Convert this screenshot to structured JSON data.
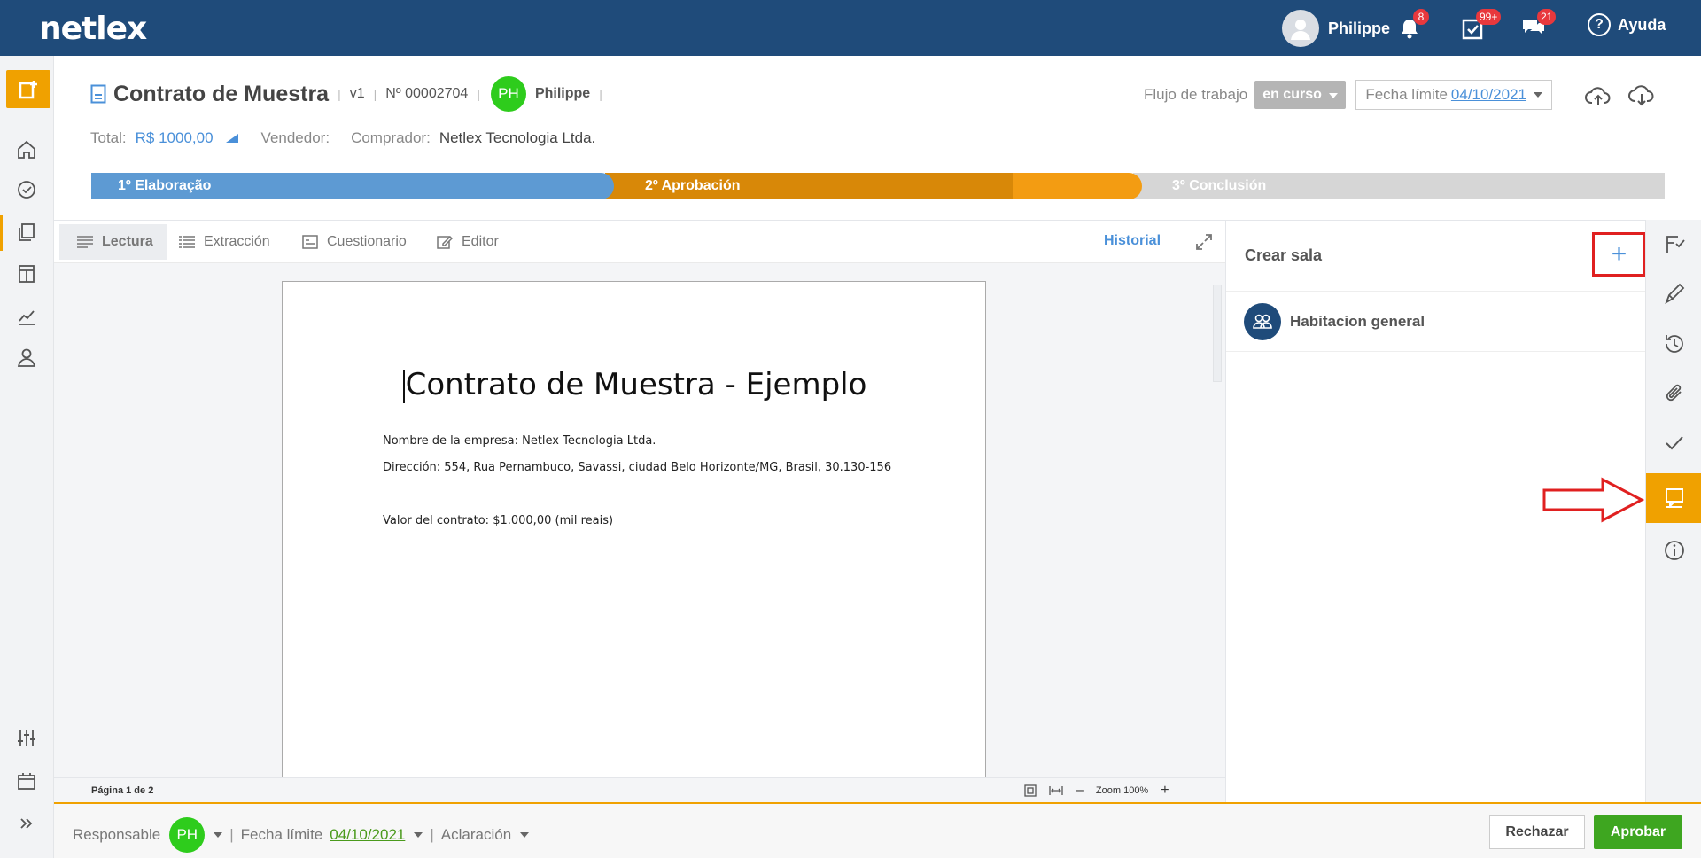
{
  "app": {
    "logo": "netlex"
  },
  "topbar": {
    "user_name": "Philippe",
    "notifications_count": "8",
    "tasks_count": "99+",
    "messages_count": "21",
    "help_label": "Ayuda"
  },
  "document": {
    "title": "Contrato de Muestra",
    "version": "v1",
    "number": "Nº 00002704",
    "owner_initials": "PH",
    "owner_name": "Philippe",
    "total_label": "Total:",
    "total_value": "R$ 1000,00",
    "seller_label": "Vendedor:",
    "buyer_label": "Comprador:",
    "buyer_value": "Netlex Tecnologia Ltda.",
    "workflow_label": "Flujo de trabajo",
    "workflow_status": "en curso",
    "deadline_label": "Fecha límite",
    "deadline_value": "04/10/2021"
  },
  "stages": [
    {
      "label": "1º Elaboração",
      "color": "#5d9ad3"
    },
    {
      "label": "2º Aprobación",
      "color": "#f39c12"
    },
    {
      "label": "3º Conclusión",
      "color": "#d6d6d6"
    }
  ],
  "tabs": {
    "reading": "Lectura",
    "extraction": "Extracción",
    "questionnaire": "Cuestionario",
    "editor": "Editor",
    "history": "Historial"
  },
  "page_content": {
    "heading": "Contrato de Muestra - Ejemplo",
    "line1": "Nombre de la empresa: Netlex Tecnologia Ltda.",
    "line2": "Dirección: 554, Rua Pernambuco, Savassi, ciudad Belo Horizonte/MG, Brasil, 30.130-156",
    "line3": "Valor del contrato: $1.000,00 (mil reais)"
  },
  "viewer_status": {
    "pages": "Página 1 de 2",
    "zoom": "Zoom 100%"
  },
  "chat": {
    "title": "Crear sala",
    "add_symbol": "+",
    "rooms": [
      {
        "name": "Habitacion general"
      }
    ]
  },
  "bottombar": {
    "responsible_label": "Responsable",
    "responsible_initials": "PH",
    "deadline_label": "Fecha límite",
    "deadline_value": "04/10/2021",
    "clarification_label": "Aclaración",
    "reject_label": "Rechazar",
    "approve_label": "Aprobar"
  },
  "colors": {
    "primary": "#1f4b7a",
    "accent": "#f0a100",
    "approve": "#3ea620",
    "link": "#4a90d9",
    "highlight": "#e02020"
  },
  "icons": {
    "rail": [
      "workflow-check-icon",
      "pen-icon",
      "history-icon",
      "attachment-icon",
      "check-icon",
      "chat-icon",
      "info-icon"
    ],
    "nav": [
      "home-icon",
      "tasks-icon",
      "documents-icon",
      "templates-icon",
      "reports-icon",
      "user-icon",
      "settings-sliders-icon",
      "calendar-icon"
    ]
  }
}
